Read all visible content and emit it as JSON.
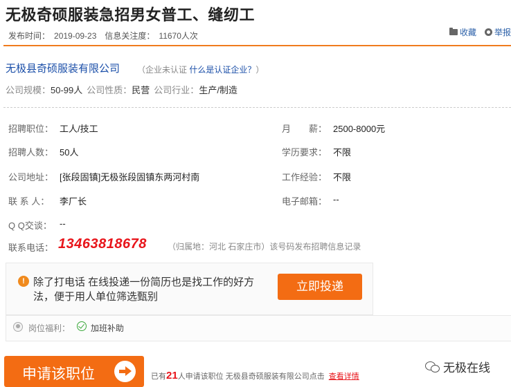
{
  "header": {
    "title": "无极奇硕服装急招男女普工、缝纫工",
    "publish_label": "发布时间：",
    "publish_date": "2019-09-23",
    "attention_label": "信息关注度：",
    "attention_value": "11670人次",
    "favorite_label": "收藏",
    "report_label": "举报"
  },
  "company": {
    "name": "无极县奇硕服装有限公司",
    "cert_open": "（企业未认证 ",
    "cert_link": "什么是认证企业？",
    "cert_close": "）",
    "scale_label": "公司规模：",
    "scale_value": "50-99人",
    "nature_label": "公司性质：",
    "nature_value": "民营",
    "industry_label": "公司行业：",
    "industry_value": "生产/制造"
  },
  "details": {
    "position_label": "招聘职位：",
    "position_value": "工人/技工",
    "salary_label": "月　　薪：",
    "salary_value": "2500-8000元",
    "headcount_label": "招聘人数：",
    "headcount_value": "50人",
    "education_label": "学历要求：",
    "education_value": "不限",
    "address_label": "公司地址：",
    "address_value": "[张段固镇]无极张段固镇东两河村南",
    "experience_label": "工作经验：",
    "experience_value": "不限",
    "contact_label": "联 系 人：",
    "contact_value": "李厂长",
    "email_label": "电子邮箱：",
    "email_value": "--",
    "qq_label": "Q Q交谈：",
    "qq_value": "--",
    "phone_label": "联系电话：",
    "phone_value": "13463818678",
    "phone_note": "（归属地：河北 石家庄市）该号码发布招聘信息记录"
  },
  "tip": {
    "text": "除了打电话 在线投递一份简历也是找工作的好方法，便于用人单位筛选甄别",
    "button": "立即投递"
  },
  "welfare": {
    "label": "岗位福利：",
    "item": "加班补助"
  },
  "apply": {
    "button": "申请该职位",
    "prefix": "已有",
    "count": "21",
    "suffix": "人申请该职位 无极县奇硕服装有限公司点击",
    "link": "查看详情"
  },
  "watermark": {
    "text": "无极在线"
  },
  "colors": {
    "accent": "#f36c13",
    "link": "#1a4ea8",
    "phone": "#e8141a"
  }
}
